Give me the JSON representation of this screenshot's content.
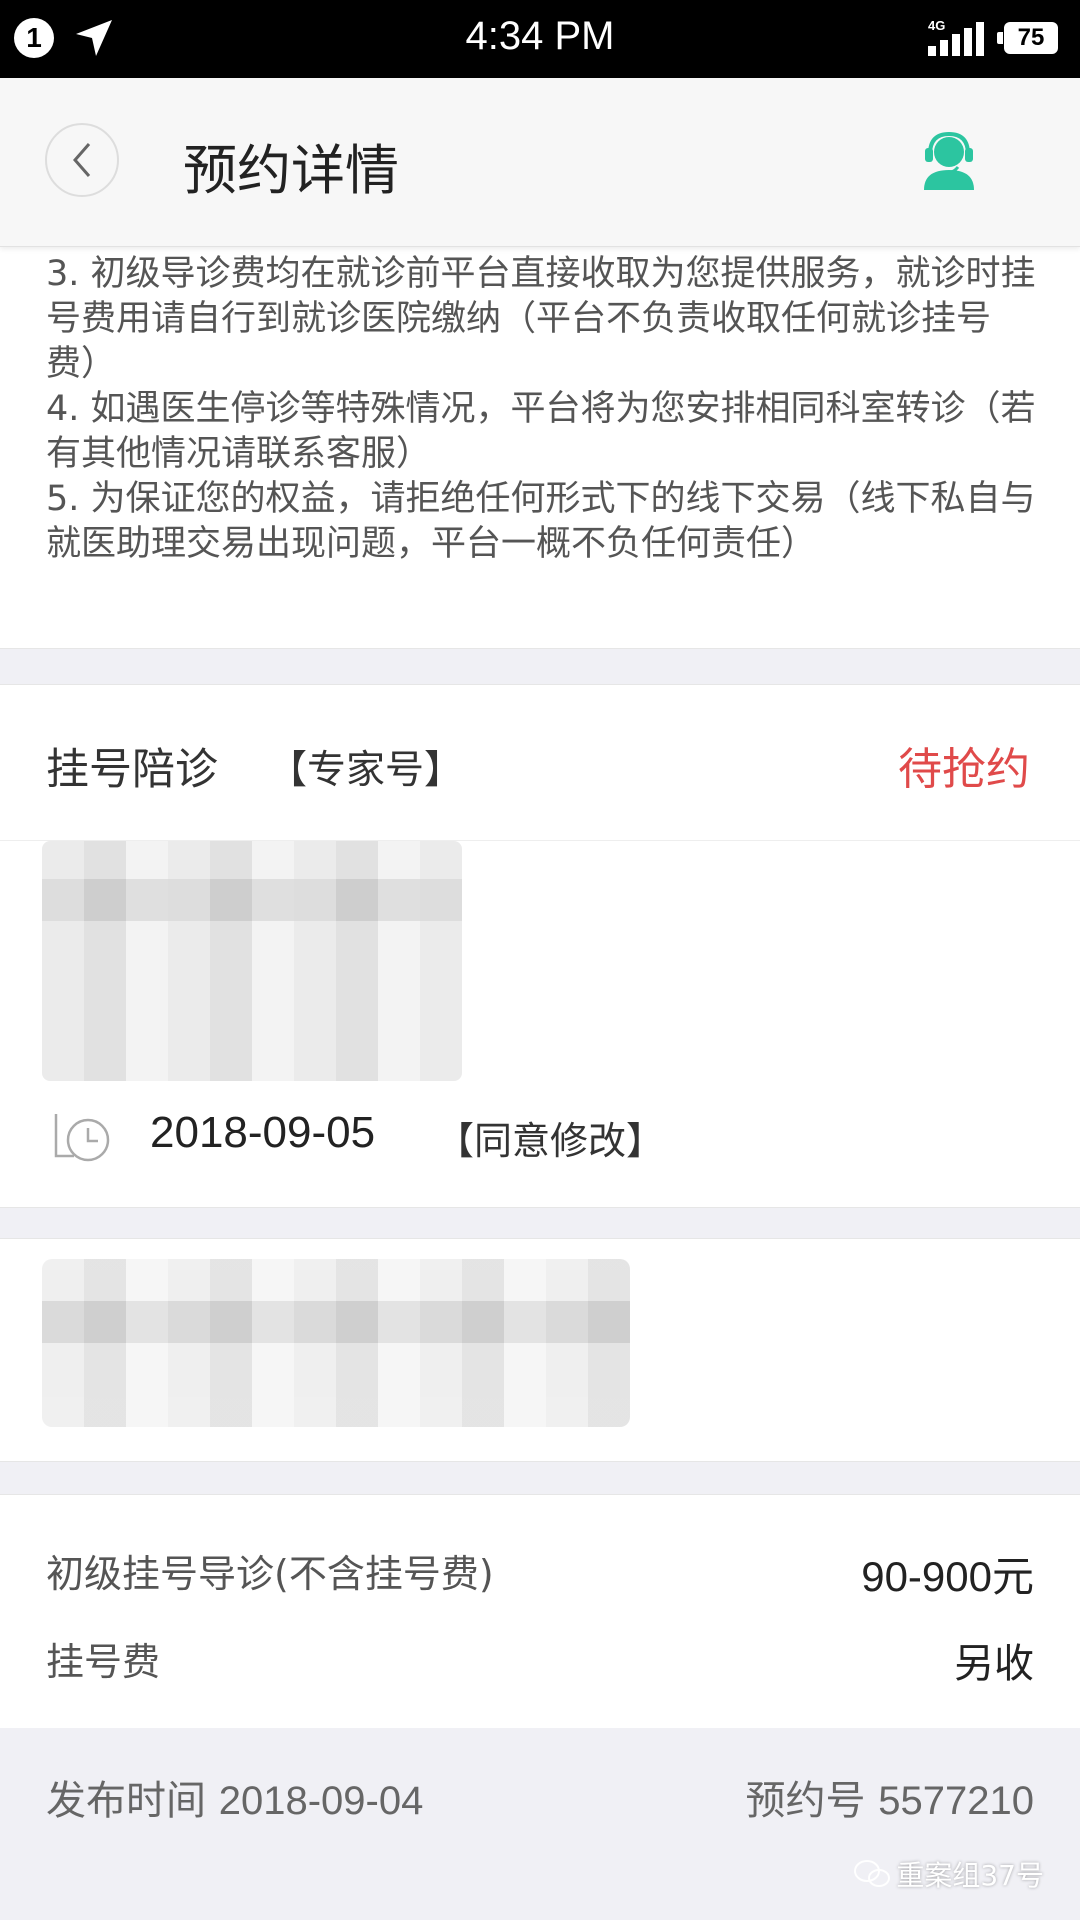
{
  "status_bar": {
    "notification_count": "1",
    "time": "4:34 PM",
    "network": "4G",
    "battery": "75"
  },
  "header": {
    "title": "预约详情"
  },
  "notice": {
    "items": [
      "3. 初级导诊费均在就诊前平台直接收取为您提供服务，就诊时挂号费用请自行到就诊医院缴纳（平台不负责收取任何就诊挂号费）",
      "4. 如遇医生停诊等特殊情况，平台将为您安排相同科室转诊（若有其他情况请联系客服）",
      "5. 为保证您的权益，请拒绝任何形式下的线下交易（线下私自与就医助理交易出现问题，平台一概不负任何责任）"
    ]
  },
  "service": {
    "title": "挂号陪诊",
    "type": "【专家号】",
    "status": "待抢约",
    "status_color": "#e04a4a",
    "date": "2018-09-05",
    "date_note": "【同意修改】"
  },
  "fees": {
    "rows": [
      {
        "label": "初级挂号导诊(不含挂号费)",
        "value": "90-900元"
      },
      {
        "label": "挂号费",
        "value": "另收"
      }
    ]
  },
  "footer": {
    "publish_label": "发布时间",
    "publish_date": "2018-09-04",
    "order_label": "预约号",
    "order_number": "5577210",
    "watermark": "重案组37号"
  },
  "colors": {
    "accent_teal": "#2cc5a0",
    "status_red": "#e04a4a"
  }
}
